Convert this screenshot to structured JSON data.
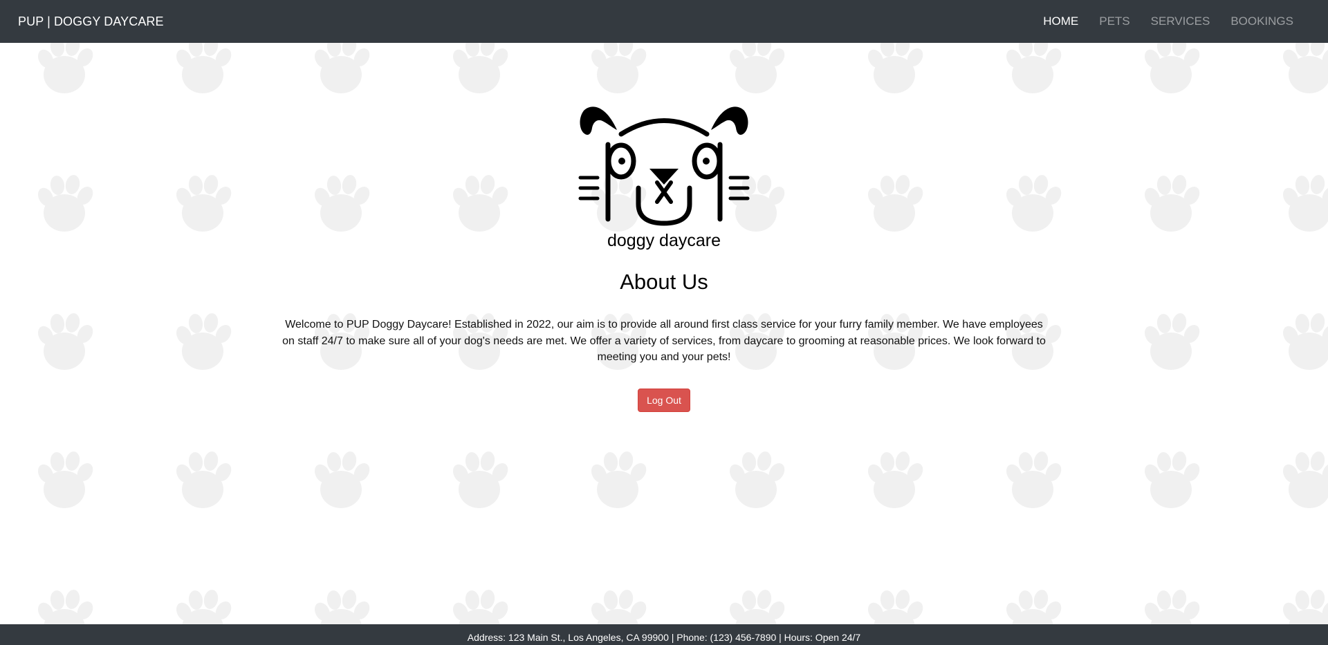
{
  "navbar": {
    "brand": "PUP | DOGGY DAYCARE",
    "links": [
      {
        "label": "HOME",
        "active": true
      },
      {
        "label": "PETS",
        "active": false
      },
      {
        "label": "SERVICES",
        "active": false
      },
      {
        "label": "BOOKINGS",
        "active": false
      }
    ]
  },
  "logo": {
    "icon": "dog-face-logo",
    "caption": "doggy daycare"
  },
  "about": {
    "title": "About Us",
    "text": "Welcome to PUP Doggy Daycare! Established in 2022, our aim is to provide all around first class service for your furry family member. We have employees on staff 24/7 to make sure all of your dog's needs are met. We offer a variety of services, from daycare to grooming at reasonable prices. We look forward to meeting you and your pets!"
  },
  "actions": {
    "logout_label": "Log Out"
  },
  "footer": {
    "text": "Address: 123 Main St., Los Angeles, CA 99900 | Phone: (123) 456-7890 | Hours: Open 24/7"
  },
  "colors": {
    "navbar_bg": "#343a40",
    "danger": "#d9534f",
    "paw_pattern": "#f0f0f0"
  }
}
